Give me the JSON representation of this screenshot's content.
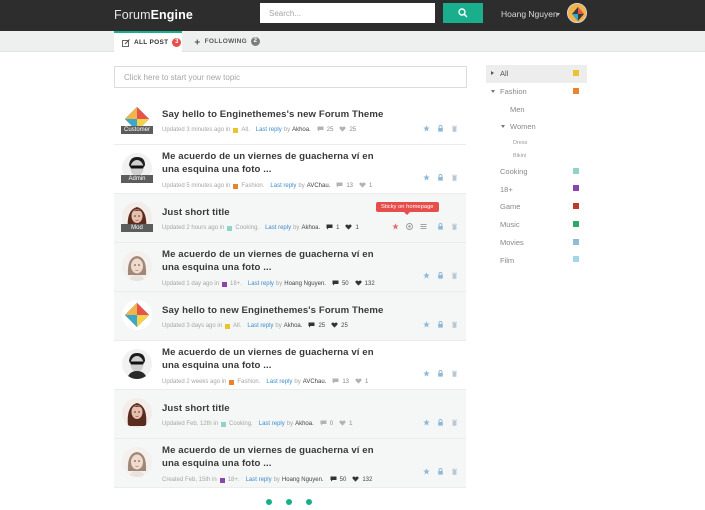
{
  "header": {
    "logo_light": "Forum",
    "logo_bold": "Engine",
    "search_placeholder": "Search...",
    "username": "Hoang Nguyen"
  },
  "tabs": [
    {
      "label": "ALL POST",
      "count": "3",
      "count_color": "#e54e4b"
    },
    {
      "label": "FOLLOWING",
      "count": "2",
      "count_color": "#7d7d7d"
    }
  ],
  "new_topic_placeholder": "Click here to start your new topic",
  "colors": {
    "accent": "#1aaf8c",
    "link": "#3c8dcb",
    "badge_red": "#e54e4b"
  },
  "topics": [
    {
      "title": "Say hello to Enginethemes's new Forum Theme",
      "role": "Customer",
      "avatar": "logo",
      "time": "Updated 3 minutes ago in",
      "category": "All.",
      "cat_color": "#e9c42e",
      "last_reply": "Last reply",
      "by": "by",
      "author": "Akhoa.",
      "comments": "25",
      "likes": "25",
      "dark_stats": false,
      "alt": false
    },
    {
      "title": "Me acuerdo de un viernes de guacherna ví en una esquina una foto ...",
      "role": "Admin",
      "avatar": "man",
      "time": "Updated 5 minutes ago in",
      "category": "Fashion.",
      "cat_color": "#e8832e",
      "last_reply": "Last reply",
      "by": "by",
      "author": "AVChau.",
      "comments": "13",
      "likes": "1",
      "dark_stats": false,
      "alt": false
    },
    {
      "title": "Just short title",
      "role": "Mod",
      "avatar": "woman",
      "time": "Updated 2 hours ago in",
      "category": "Cooking.",
      "cat_color": "#8fd3c9",
      "last_reply": "Last reply",
      "by": "by",
      "author": "Akhoa.",
      "comments": "1",
      "likes": "1",
      "dark_stats": true,
      "alt": true,
      "tooltip": "Sticky on homepage"
    },
    {
      "title": "Me acuerdo de un viernes de guacherna ví en una esquina una foto ...",
      "role": "",
      "avatar": "girl",
      "time": "Updated 1 day ago in",
      "category": "18+.",
      "cat_color": "#8e44ad",
      "last_reply": "Last reply",
      "by": "by",
      "author": "Hoang Nguyen.",
      "comments": "50",
      "likes": "132",
      "dark_stats": true,
      "alt": true
    },
    {
      "title": "Say hello to new Enginethemes's Forum Theme",
      "role": "",
      "avatar": "logo",
      "time": "Updated 3 days ago in",
      "category": "All.",
      "cat_color": "#e9c42e",
      "last_reply": "Last reply",
      "by": "by",
      "author": "Akhoa.",
      "comments": "25",
      "likes": "25",
      "dark_stats": true,
      "alt": true
    },
    {
      "title": "Me acuerdo de un viernes de guacherna ví en una esquina una foto ...",
      "role": "",
      "avatar": "man",
      "time": "Updated 2 weeks ago in",
      "category": "Fashion.",
      "cat_color": "#e8832e",
      "last_reply": "Last reply",
      "by": "by",
      "author": "AVChau.",
      "comments": "13",
      "likes": "1",
      "dark_stats": false,
      "alt": false
    },
    {
      "title": "Just short title",
      "role": "",
      "avatar": "woman",
      "time": "Updated Feb, 12th in",
      "category": "Cooking.",
      "cat_color": "#8fd3c9",
      "last_reply": "Last reply",
      "by": "by",
      "author": "Akhoa.",
      "comments": "0",
      "likes": "1",
      "dark_stats": false,
      "alt": true
    },
    {
      "title": "Me acuerdo de un viernes de guacherna ví en una esquina una foto ...",
      "role": "",
      "avatar": "girl",
      "time": "Created Feb, 15th in",
      "category": "18+.",
      "cat_color": "#8e44ad",
      "last_reply": "Last reply",
      "by": "by",
      "author": "Hoang Nguyen.",
      "comments": "50",
      "likes": "132",
      "dark_stats": true,
      "alt": true
    }
  ],
  "categories": [
    {
      "label": "All",
      "color": "#e9c42e",
      "level": 0,
      "arrow": "right",
      "active": true
    },
    {
      "label": "Fashion",
      "color": "#e8832e",
      "level": 0,
      "arrow": "down"
    },
    {
      "label": "Men",
      "color": "",
      "level": 1
    },
    {
      "label": "Women",
      "color": "",
      "level": 1,
      "arrow": "down"
    },
    {
      "label": "Dress",
      "color": "",
      "level": 2
    },
    {
      "label": "Bikini",
      "color": "",
      "level": 2
    },
    {
      "label": "Cooking",
      "color": "#8fd3c9",
      "level": 0
    },
    {
      "label": "18+",
      "color": "#8e44ad",
      "level": 0
    },
    {
      "label": "Game",
      "color": "#c0392b",
      "level": 0
    },
    {
      "label": "Music",
      "color": "#27ae60",
      "level": 0
    },
    {
      "label": "Movies",
      "color": "#8fbfd8",
      "level": 0
    },
    {
      "label": "Film",
      "color": "#a5d5e6",
      "level": 0
    }
  ],
  "pagination": {
    "pages": 3
  }
}
